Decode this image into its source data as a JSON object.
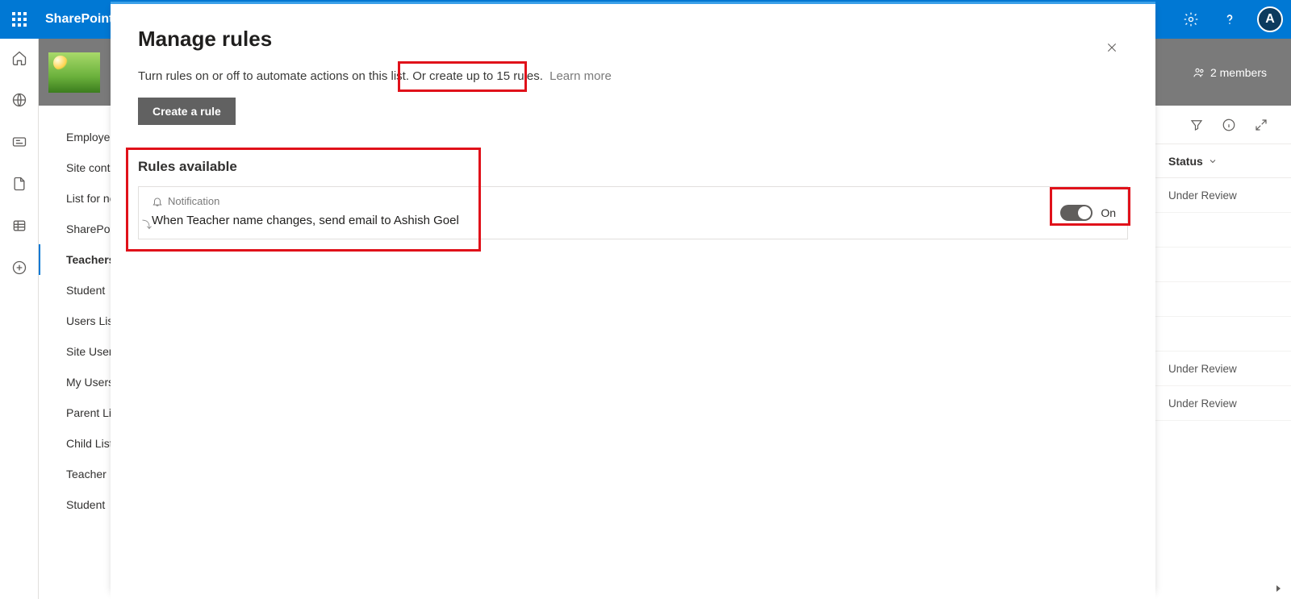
{
  "suite": {
    "app_name": "SharePoint",
    "avatar_initial": "A"
  },
  "site": {
    "members_label": "2 members"
  },
  "quick_launch": {
    "items": [
      {
        "label": "Employee"
      },
      {
        "label": "Site contents"
      },
      {
        "label": "List for notifications"
      },
      {
        "label": "SharePoint"
      },
      {
        "label": "Teachers"
      },
      {
        "label": "Student"
      },
      {
        "label": "Users List"
      },
      {
        "label": "Site Users"
      },
      {
        "label": "My Users"
      },
      {
        "label": "Parent List"
      },
      {
        "label": "Child List"
      },
      {
        "label": "Teacher"
      },
      {
        "label": "Student"
      }
    ],
    "active_index": 4
  },
  "peek": {
    "column_header": "Status",
    "rows": [
      "Under Review",
      "",
      "",
      "",
      "",
      "Under Review",
      "Under Review"
    ]
  },
  "modal": {
    "title": "Manage rules",
    "description_part1": "Turn rules on or off to automate actions on this list. ",
    "description_part2": "Or create up to 15 rules.",
    "learn_more": "Learn more",
    "create_button": "Create a rule",
    "section_title": "Rules available",
    "rule": {
      "type_label": "Notification",
      "description": "When Teacher name changes, send email to Ashish Goel",
      "toggle_label": "On",
      "toggle_on": true
    }
  }
}
